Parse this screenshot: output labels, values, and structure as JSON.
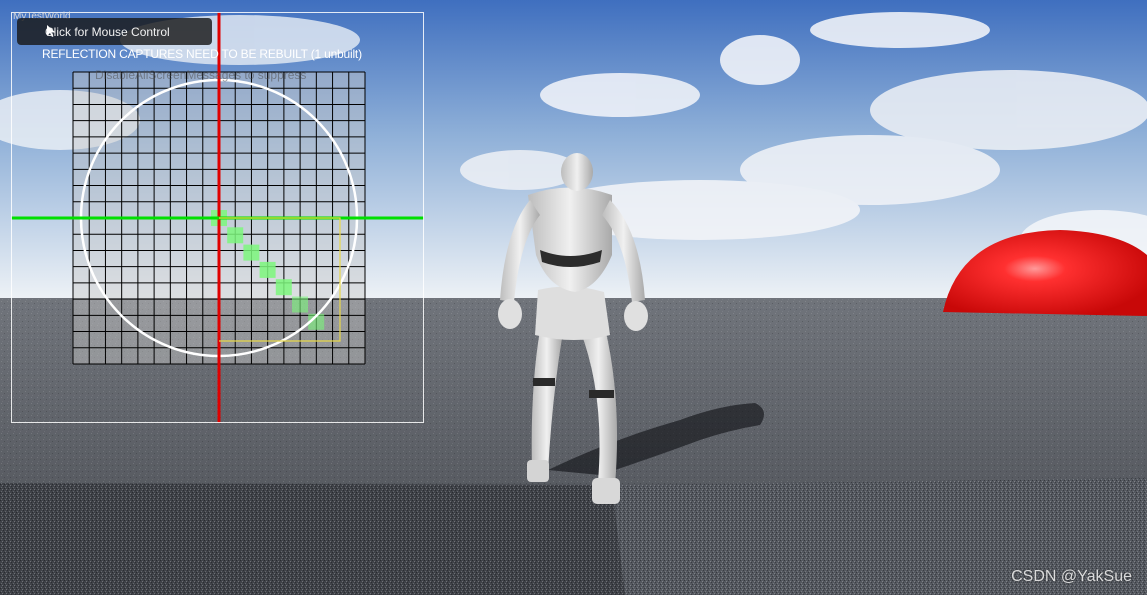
{
  "overlay": {
    "world_label": "MyTestWorld",
    "mouse_control_label": "Click for Mouse Control",
    "rebuild_warning": "REFLECTION CAPTURES NEED TO BE REBUILT (1 unbuilt)",
    "suppress_hint": "DisableAllScreenMessages to suppress"
  },
  "watermark": "CSDN @YakSue",
  "colors": {
    "sky_top": "#4f7bc4",
    "sky_horizon": "#e3ebf3",
    "ground": "#5c6068",
    "sphere": "#e81e1e",
    "axis_x": "#00e000",
    "axis_y": "#e00000",
    "path_cells": "#7cf77c",
    "window_border": "#000000"
  },
  "icons": {
    "cursor": "mouse-cursor-icon"
  }
}
